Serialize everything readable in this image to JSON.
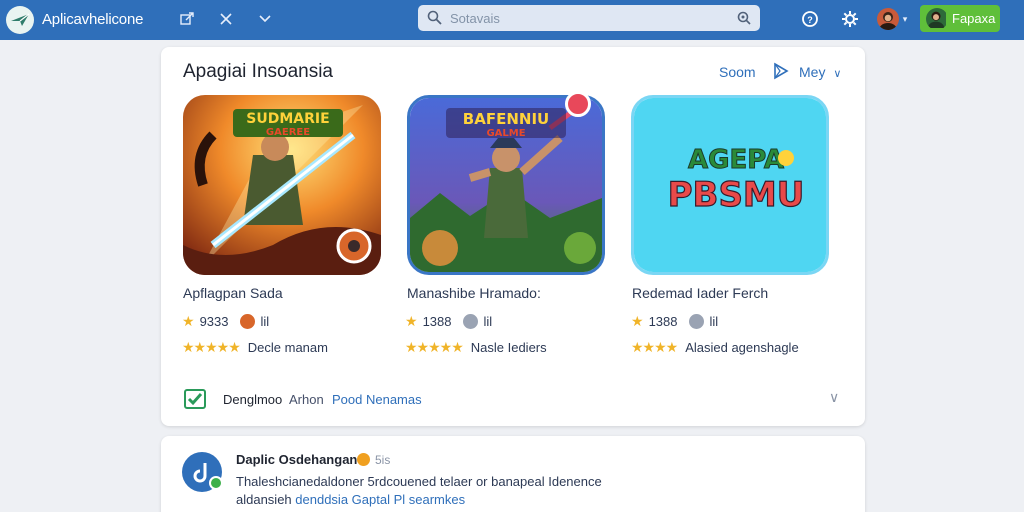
{
  "topbar": {
    "app_title": "Aplicavhelicone",
    "search_placeholder": "Sotavais",
    "action_button_label": "Fapaxa"
  },
  "section": {
    "title": "Apagiai Insoansia",
    "link_a": "Soom",
    "link_b": "Mey"
  },
  "apps": [
    {
      "art_text_top": "SUDMARIE",
      "art_text_sub": "GAEREE",
      "name": "Apflagpan Sada",
      "rating": "9333",
      "meta": "lil",
      "tagline": "Decle manam",
      "badge_color": "#d8662a",
      "dot_color": "#d8662a"
    },
    {
      "art_text_top": "BAFENNIU",
      "art_text_sub": "GALME",
      "name": "Manashibe Hramado:",
      "rating": "1388",
      "meta": "lil",
      "tagline": "Nasle Iediers",
      "dot_color": "#9aa3b3"
    },
    {
      "art_text_top": "AGEPA",
      "art_text_sub": "PBSMU",
      "name": "Redemad Iader Ferch",
      "rating": "1388",
      "meta": "lil",
      "tagline": "Alasied agenshagle",
      "dot_color": "#9aa3b3"
    }
  ],
  "footer": {
    "bold": "Denglmoo",
    "grey": "Arhon",
    "blue": "Pood Nenamas"
  },
  "post": {
    "author": "Daplic Osdehangan",
    "count": "5is",
    "line1": "Thaleshcianedaldoner 5rdcouened telaer or banapeal Idenence",
    "line2_plain": "aldansieh",
    "line2_link": "denddsia Gaptal Pl searmkes"
  }
}
